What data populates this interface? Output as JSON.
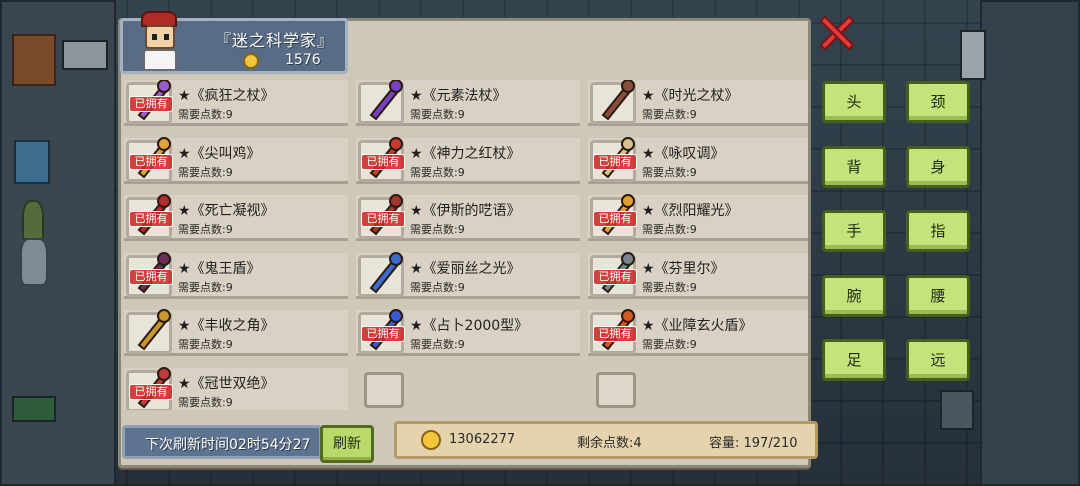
{
  "header": {
    "title": "『迷之科学家』",
    "gold": "1576"
  },
  "owned_label": "已拥有",
  "items": [
    [
      {
        "name": "★《疯狂之杖》",
        "req": "需要点数:9",
        "owned": true,
        "icon": "wand-icon",
        "color": "#9a5bd1"
      },
      {
        "name": "★《元素法杖》",
        "req": "需要点数:9",
        "owned": false,
        "icon": "staff-icon",
        "color": "#7a3fc2"
      },
      {
        "name": "★《时光之杖》",
        "req": "需要点数:9",
        "owned": false,
        "icon": "clock-staff-icon",
        "color": "#8a4d3d"
      }
    ],
    [
      {
        "name": "★《尖叫鸡》",
        "req": "需要点数:9",
        "owned": true,
        "icon": "chicken-icon",
        "color": "#e2a43a"
      },
      {
        "name": "★《神力之红杖》",
        "req": "需要点数:9",
        "owned": true,
        "icon": "red-staff-icon",
        "color": "#c83b2a"
      },
      {
        "name": "★《咏叹调》",
        "req": "需要点数:9",
        "owned": true,
        "icon": "wing-staff-icon",
        "color": "#d8c28a"
      }
    ],
    [
      {
        "name": "★《死亡凝视》",
        "req": "需要点数:9",
        "owned": true,
        "icon": "spear-icon",
        "color": "#b62b2b"
      },
      {
        "name": "★《伊斯的呓语》",
        "req": "需要点数:9",
        "owned": true,
        "icon": "dark-spear-icon",
        "color": "#9e3a2a"
      },
      {
        "name": "★《烈阳耀光》",
        "req": "需要点数:9",
        "owned": true,
        "icon": "sun-spear-icon",
        "color": "#e3a02a"
      }
    ],
    [
      {
        "name": "★《鬼王盾》",
        "req": "需要点数:9",
        "owned": true,
        "icon": "demon-shield-icon",
        "color": "#6b2e5a"
      },
      {
        "name": "★《爱丽丝之光》",
        "req": "需要点数:9",
        "owned": false,
        "icon": "flashlight-icon",
        "color": "#3a6bd1"
      },
      {
        "name": "★《芬里尔》",
        "req": "需要点数:9",
        "owned": true,
        "icon": "wolf-shield-icon",
        "color": "#7b8592"
      }
    ],
    [
      {
        "name": "★《丰收之角》",
        "req": "需要点数:9",
        "owned": false,
        "icon": "horn-icon",
        "color": "#c8972e"
      },
      {
        "name": "★《占卜2000型》",
        "req": "需要点数:9",
        "owned": true,
        "icon": "orb-icon",
        "color": "#3c58d6"
      },
      {
        "name": "★《业障玄火盾》",
        "req": "需要点数:9",
        "owned": true,
        "icon": "fire-shield-icon",
        "color": "#d25a22"
      }
    ],
    [
      {
        "name": "★《冠世双绝》",
        "req": "需要点数:9",
        "owned": true,
        "icon": "twin-blade-icon",
        "color": "#c33a3a"
      },
      null,
      null
    ]
  ],
  "footer": {
    "refresh_timer": "下次刷新时间02时54分27",
    "refresh_button": "刷新",
    "money": "13062277",
    "points": "剩余点数:4",
    "capacity": "容量:  197/210"
  },
  "slots": [
    "头",
    "颈",
    "背",
    "身",
    "手",
    "指",
    "腕",
    "腰",
    "足",
    "远"
  ]
}
